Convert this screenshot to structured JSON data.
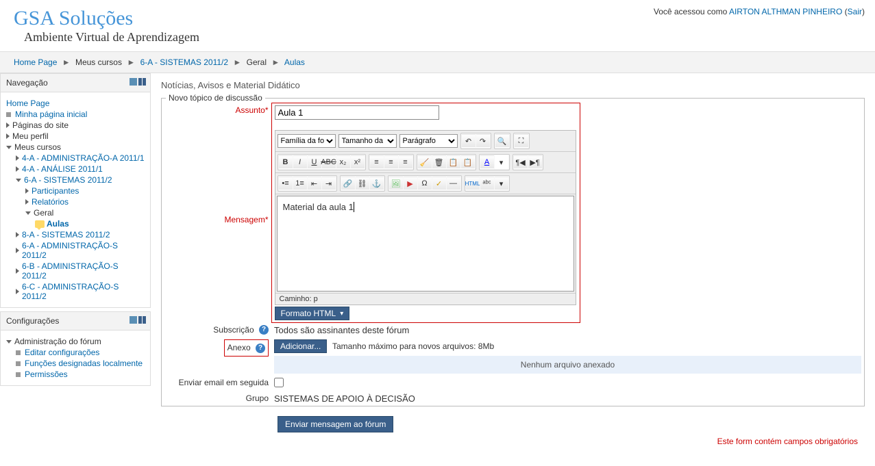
{
  "header": {
    "logo": "GSA Soluções",
    "subtitle": "Ambiente Virtual de Aprendizagem",
    "login_prefix": "Você acessou como ",
    "user_name": "AIRTON ALTHMAN PINHEIRO",
    "logout": "Sair"
  },
  "breadcrumb": {
    "items": [
      "Home Page",
      "Meus cursos",
      "6-A - SISTEMAS 2011/2",
      "Geral",
      "Aulas"
    ]
  },
  "nav_block": {
    "title": "Navegação",
    "home": "Home Page",
    "my_page": "Minha página inicial",
    "site_pages": "Páginas do site",
    "my_profile": "Meu perfil",
    "my_courses": "Meus cursos",
    "course1": "4-A - ADMINISTRAÇÃO-A 2011/1",
    "course2": "4-A - ANÁLISE 2011/1",
    "course3": "6-A - SISTEMAS 2011/2",
    "participants": "Participantes",
    "reports": "Relatórios",
    "general": "Geral",
    "aulas": "Aulas",
    "course4": "8-A - SISTEMAS 2011/2",
    "course5": "6-A - ADMINISTRAÇÃO-S 2011/2",
    "course6": "6-B - ADMINISTRAÇÃO-S 2011/2",
    "course7": "6-C - ADMINISTRAÇÃO-S 2011/2"
  },
  "config_block": {
    "title": "Configurações",
    "admin_forum": "Administração do fórum",
    "edit_config": "Editar configurações",
    "local_roles": "Funções designadas localmente",
    "permissions": "Permissões"
  },
  "main": {
    "subtitle": "Notícias, Avisos e Material Didático",
    "legend": "Novo tópico de discussão",
    "subject_label": "Assunto",
    "subject_value": "Aula 1",
    "message_label": "Mensagem",
    "font_family": "Família da font",
    "font_size": "Tamanho da fo",
    "paragraph": "Parágrafo",
    "editor_content": "Material da aula 1",
    "path_label": "Caminho: p",
    "format_html": "Formato HTML",
    "subscription_label": "Subscrição",
    "subscription_value": "Todos são assinantes deste fórum",
    "attachment_label": "Anexo",
    "add_btn": "Adicionar...",
    "max_size": "Tamanho máximo para novos arquivos: 8Mb",
    "no_file": "Nenhum arquivo anexado",
    "send_now_label": "Enviar email em seguida",
    "group_label": "Grupo",
    "group_value": "SISTEMAS DE APOIO À DECISÃO",
    "submit": "Enviar mensagem ao fórum",
    "required_note": "Este form contém campos obrigatórios"
  }
}
